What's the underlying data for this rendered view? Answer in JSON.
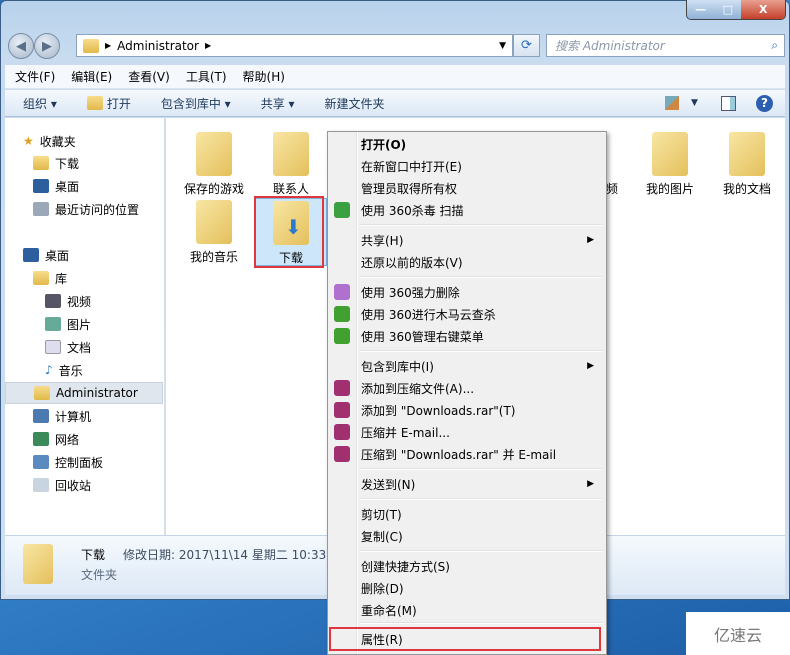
{
  "window": {
    "controls": {
      "minimize": "—",
      "maximize": "□",
      "close": "X"
    }
  },
  "address": {
    "path": "Administrator",
    "search_placeholder": "搜索 Administrator"
  },
  "menubar": [
    "文件(F)",
    "编辑(E)",
    "查看(V)",
    "工具(T)",
    "帮助(H)"
  ],
  "toolbar": {
    "organize": "组织 ▾",
    "open": "打开",
    "include": "包含到库中 ▾",
    "share": "共享 ▾",
    "new_folder": "新建文件夹"
  },
  "sidebar": {
    "favorites": "收藏夹",
    "fav_items": [
      "下载",
      "桌面",
      "最近访问的位置"
    ],
    "desktop": "桌面",
    "library": "库",
    "lib_items": [
      "视频",
      "图片",
      "文档",
      "音乐"
    ],
    "other": [
      "Administrator",
      "计算机",
      "网络",
      "控制面板",
      "回收站"
    ],
    "selected": "Administrator"
  },
  "files": [
    "保存的游戏",
    "联系人",
    "视频",
    "我的图片",
    "我的文档",
    "我的音乐",
    "下载"
  ],
  "details": {
    "name": "下载",
    "modified": "修改日期: 2017\\11\\14 星期二 10:33",
    "type": "文件夹"
  },
  "context_menu": [
    {
      "label": "打开(O)",
      "bold": true
    },
    {
      "label": "在新窗口中打开(E)"
    },
    {
      "label": "管理员取得所有权"
    },
    {
      "label": "使用 360杀毒 扫描",
      "icon": "shield-icon"
    },
    {
      "label": "共享(H)",
      "submenu": true
    },
    {
      "label": "还原以前的版本(V)"
    },
    {
      "label": "使用 360强力删除",
      "icon": "shred-icon"
    },
    {
      "label": "使用 360进行木马云查杀",
      "icon": "360-icon"
    },
    {
      "label": "使用 360管理右键菜单",
      "icon": "360-icon"
    },
    {
      "label": "包含到库中(I)",
      "submenu": true
    },
    {
      "label": "添加到压缩文件(A)...",
      "icon": "winrar-icon"
    },
    {
      "label": "添加到 \"Downloads.rar\"(T)",
      "icon": "winrar-icon"
    },
    {
      "label": "压缩并 E-mail...",
      "icon": "winrar-icon"
    },
    {
      "label": "压缩到 \"Downloads.rar\" 并 E-mail",
      "icon": "winrar-icon"
    },
    {
      "label": "发送到(N)",
      "submenu": true
    },
    {
      "label": "剪切(T)"
    },
    {
      "label": "复制(C)"
    },
    {
      "label": "创建快捷方式(S)"
    },
    {
      "label": "删除(D)"
    },
    {
      "label": "重命名(M)"
    },
    {
      "label": "属性(R)"
    }
  ],
  "watermark": "亿速云",
  "colors": {
    "highlight": "#e0373f"
  }
}
